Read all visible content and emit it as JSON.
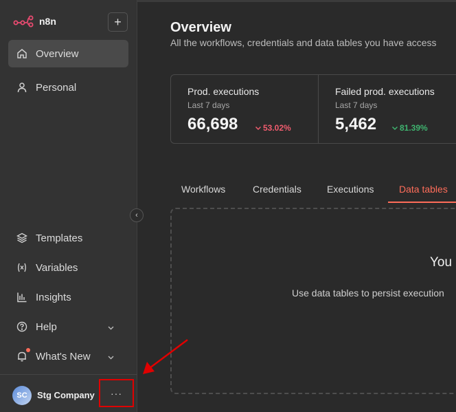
{
  "app": {
    "name": "n8n"
  },
  "sidebar": {
    "add_label": "+",
    "primary": [
      {
        "label": "Overview",
        "icon": "home-icon",
        "active": true
      },
      {
        "label": "Personal",
        "icon": "user-icon",
        "active": false
      }
    ],
    "secondary": [
      {
        "label": "Templates",
        "icon": "templates-icon"
      },
      {
        "label": "Variables",
        "icon": "variables-icon"
      },
      {
        "label": "Insights",
        "icon": "insights-icon"
      },
      {
        "label": "Help",
        "icon": "help-icon",
        "chevron": true
      },
      {
        "label": "What's New",
        "icon": "bell-icon",
        "chevron": true
      }
    ],
    "collapse_icon": "‹",
    "user": {
      "initials": "SC",
      "name": "Stg Company",
      "more": "···"
    }
  },
  "main": {
    "title": "Overview",
    "subtitle": "All the workflows, credentials and data tables you have access",
    "stats": [
      {
        "title": "Prod. executions",
        "period": "Last 7 days",
        "value": "66,698",
        "change": "53.02%",
        "direction": "down",
        "color": "#f05c6e"
      },
      {
        "title": "Failed prod. executions",
        "period": "Last 7 days",
        "value": "5,462",
        "change": "81.39%",
        "direction": "down",
        "color": "#3fb36f"
      }
    ],
    "tabs": [
      {
        "label": "Workflows",
        "active": false
      },
      {
        "label": "Credentials",
        "active": false
      },
      {
        "label": "Executions",
        "active": false
      },
      {
        "label": "Data tables",
        "active": true
      }
    ],
    "empty_state": {
      "title": "You",
      "description": "Use data tables to persist execution"
    }
  },
  "colors": {
    "accent": "#ff6d5a",
    "annotation": "#e00000"
  }
}
